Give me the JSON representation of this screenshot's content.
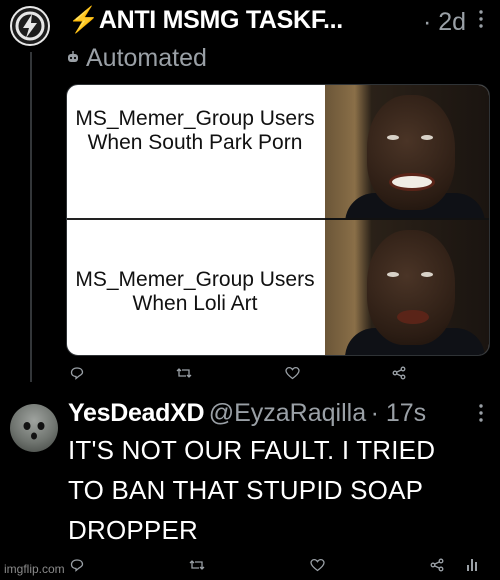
{
  "post1": {
    "author": "⚡ANTI MSMG TASKF...",
    "time": "· 2d",
    "label": "Automated",
    "meme": {
      "top_text": "MS_Memer_Group Users When South Park Porn",
      "bottom_text": "MS_Memer_Group Users When Loli Art"
    }
  },
  "post2": {
    "author": "YesDeadXD",
    "handle": "@EyzaRaqilla",
    "time": "· 17s",
    "text_line1": "IT'S NOT OUR FAULT. I TRIED",
    "text_line2": "TO BAN THAT STUPID SOAP",
    "text_line3": "DROPPER"
  },
  "icons": {
    "reply": "reply-icon",
    "retweet": "retweet-icon",
    "like": "like-icon",
    "share": "share-icon",
    "more": "more-icon"
  },
  "watermark": "imgflip.com"
}
